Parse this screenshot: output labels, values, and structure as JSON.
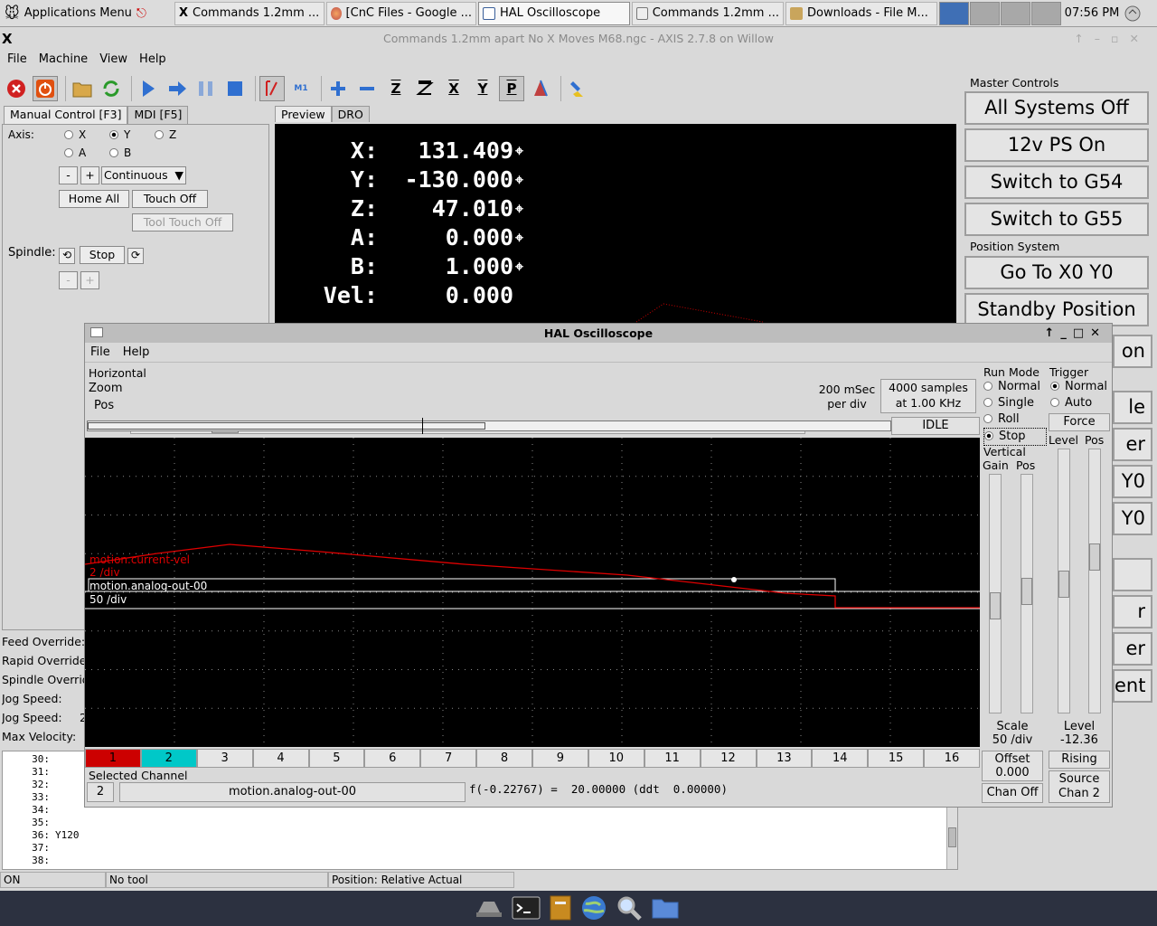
{
  "taskbar": {
    "apps_menu": "Applications Menu",
    "tasks": [
      "Commands 1.2mm ...",
      "[CnC Files - Google ...",
      "HAL Oscilloscope",
      "Commands 1.2mm ...",
      "Downloads - File M..."
    ],
    "clock": "07:56 PM"
  },
  "axis_window": {
    "logo": "X",
    "title": "Commands 1.2mm apart No X Moves M68.ngc - AXIS 2.7.8 on Willow",
    "menu": [
      "File",
      "Machine",
      "View",
      "Help"
    ],
    "toolbar_glyphs": {
      "z": "Z",
      "x": "X",
      "y": "Y",
      "p": "P",
      "m1": "M1"
    },
    "manual_tabs": [
      "Manual Control [F3]",
      "MDI [F5]"
    ],
    "axis_label": "Axis:",
    "axes": [
      "X",
      "Y",
      "Z",
      "A",
      "B"
    ],
    "selected_axis": "Y",
    "jog_minus": "-",
    "jog_plus": "+",
    "jog_mode": "Continuous",
    "home_all": "Home All",
    "touch_off": "Touch Off",
    "tool_touch_off": "Tool Touch Off",
    "spindle_label": "Spindle:",
    "spindle_stop": "Stop",
    "view_tabs": [
      "Preview",
      "DRO"
    ],
    "dro": [
      {
        "axis": "X:",
        "value": "131.409"
      },
      {
        "axis": "Y:",
        "value": "-130.000"
      },
      {
        "axis": "Z:",
        "value": "47.010"
      },
      {
        "axis": "A:",
        "value": "0.000"
      },
      {
        "axis": "B:",
        "value": "1.000"
      },
      {
        "axis": "Vel:",
        "value": "0.000"
      }
    ],
    "overrides": [
      "Feed Override:",
      "Rapid Override:",
      "Spindle Override:",
      "Jog Speed:",
      "Jog Speed:",
      "Max Velocity:"
    ],
    "jog_speed_partial": "2",
    "gcode_lines": [
      {
        "n": "30:",
        "text": ""
      },
      {
        "n": "31:",
        "text": ""
      },
      {
        "n": "32:",
        "text": ""
      },
      {
        "n": "33:",
        "text": ""
      },
      {
        "n": "34:",
        "text": ""
      },
      {
        "n": "35:",
        "text": ""
      },
      {
        "n": "36:",
        "text": "Y120"
      },
      {
        "n": "37:",
        "text": ""
      },
      {
        "n": "38:",
        "text": ""
      }
    ],
    "status": {
      "state": "ON",
      "tool": "No tool",
      "position": "Position: Relative Actual"
    }
  },
  "master_controls": {
    "title": "Master Controls",
    "buttons": [
      "All Systems Off",
      "12v PS On",
      "Switch to G54",
      "Switch to G55"
    ],
    "position_title": "Position System",
    "position_buttons": [
      "Go To X0 Y0",
      "Standby Position"
    ],
    "partial_texts": [
      "on",
      "le",
      "er",
      "Y0",
      "Y0",
      "r",
      "er",
      "ent"
    ]
  },
  "scope": {
    "title": "HAL Oscilloscope",
    "menu": [
      "File",
      "Help"
    ],
    "horizontal_label": "Horizontal",
    "zoom_label": "Zoom",
    "pos_label": "Pos",
    "zoom_fraction": 0.12,
    "pos_fraction": 0.24,
    "time_per_div": "200 mSec",
    "per_div": "per div",
    "samples": "4000 samples",
    "rate": "at 1.00 KHz",
    "state": "IDLE",
    "run_mode_label": "Run Mode",
    "run_modes": [
      "Normal",
      "Single",
      "Roll",
      "Stop"
    ],
    "run_mode_selected": "Stop",
    "trigger_label": "Trigger",
    "trigger_modes": [
      "Normal",
      "Auto"
    ],
    "trigger_selected": "Normal",
    "force": "Force",
    "level_label": "Level",
    "pos_col_label": "Pos",
    "vertical_label": "Vertical",
    "gain_label": "Gain",
    "vpos_label": "Pos",
    "trace1_name": "motion.current-vel",
    "trace1_scale": "2 /div",
    "trace2_name": "motion.analog-out-00",
    "trace2_scale": "50 /div",
    "channels": [
      "1",
      "2",
      "3",
      "4",
      "5",
      "6",
      "7",
      "8",
      "9",
      "10",
      "11",
      "12",
      "13",
      "14",
      "15",
      "16"
    ],
    "selected_channel_label": "Selected Channel",
    "selected_channel_num": "2",
    "selected_channel_name": "motion.analog-out-00",
    "readout": "f(-0.22767) =  20.00000 (ddt  0.00000)",
    "scale_label": "Scale",
    "scale_value": "50 /div",
    "offset_label": "Offset",
    "offset_value": "0.000",
    "chan_off": "Chan Off",
    "trig_level_label": "Level",
    "trig_level_value": "-12.36",
    "rising": "Rising",
    "source_label": "Source",
    "source_chan": "Chan  2",
    "colors": {
      "ch1": "#cc0000",
      "ch2": "#00c8c8",
      "trace1": "#e00000"
    }
  }
}
